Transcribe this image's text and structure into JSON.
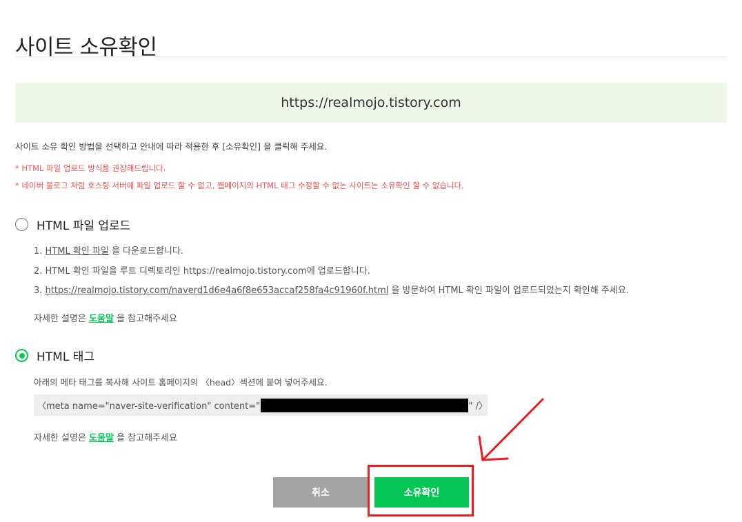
{
  "page": {
    "title": "사이트 소유확인",
    "site_url": "https://realmojo.tistory.com",
    "instruction": "사이트 소유 확인 방법을 선택하고 안내에 따라 적용한 후 [소유확인] 을 클릭해 주세요.",
    "warnings": [
      "* HTML 파일 업로드 방식을 권장해드립니다.",
      "* 네이버 블로그 처럼 호스팅 서버에 파일 업로드 할 수 없고, 웹페이지의 HTML 태그 수정할 수 없는 사이트는 소유확인 할 수 없습니다."
    ]
  },
  "options": {
    "html_file": {
      "label": "HTML 파일 업로드",
      "selected": false,
      "step1_prefix": "1. ",
      "step1_link": "HTML 확인 파일",
      "step1_suffix": " 을 다운로드합니다.",
      "step2": "2. HTML 확인 파일을 루트 디렉토리인 https://realmojo.tistory.com에 업로드합니다.",
      "step3_prefix": "3. ",
      "step3_link": "https://realmojo.tistory.com/naverd1d6e4a6f8e653accaf258fa4c91960f.html",
      "step3_suffix": " 을 방문하여 HTML 확인 파일이 업로드되었는지 확인해 주세요.",
      "help_prefix": "자세한 설명은 ",
      "help_link": "도움말",
      "help_suffix": " 을 참고해주세요"
    },
    "html_tag": {
      "label": "HTML 태그",
      "selected": true,
      "description": "아래의 메타 태그를 복사해 사이트 홈페이지의 〈head〉섹션에 붙여 넣어주세요.",
      "meta_prefix": "〈meta name=\"naver-site-verification\" content=\"",
      "meta_suffix": "\" /〉",
      "help_prefix": "자세한 설명은 ",
      "help_link": "도움말",
      "help_suffix": " 을 참고해주세요"
    }
  },
  "buttons": {
    "cancel": "취소",
    "confirm": "소유확인"
  },
  "colors": {
    "accent": "#06c755",
    "warning": "#f0544f",
    "annotation": "#e81d24",
    "site_box": "#eff7e9",
    "cancel": "#a4a4a4"
  },
  "icons": {
    "radio_unselected": "radio-empty-icon",
    "radio_selected": "radio-checked-icon",
    "annotation_arrow": "red-arrow-icon"
  }
}
